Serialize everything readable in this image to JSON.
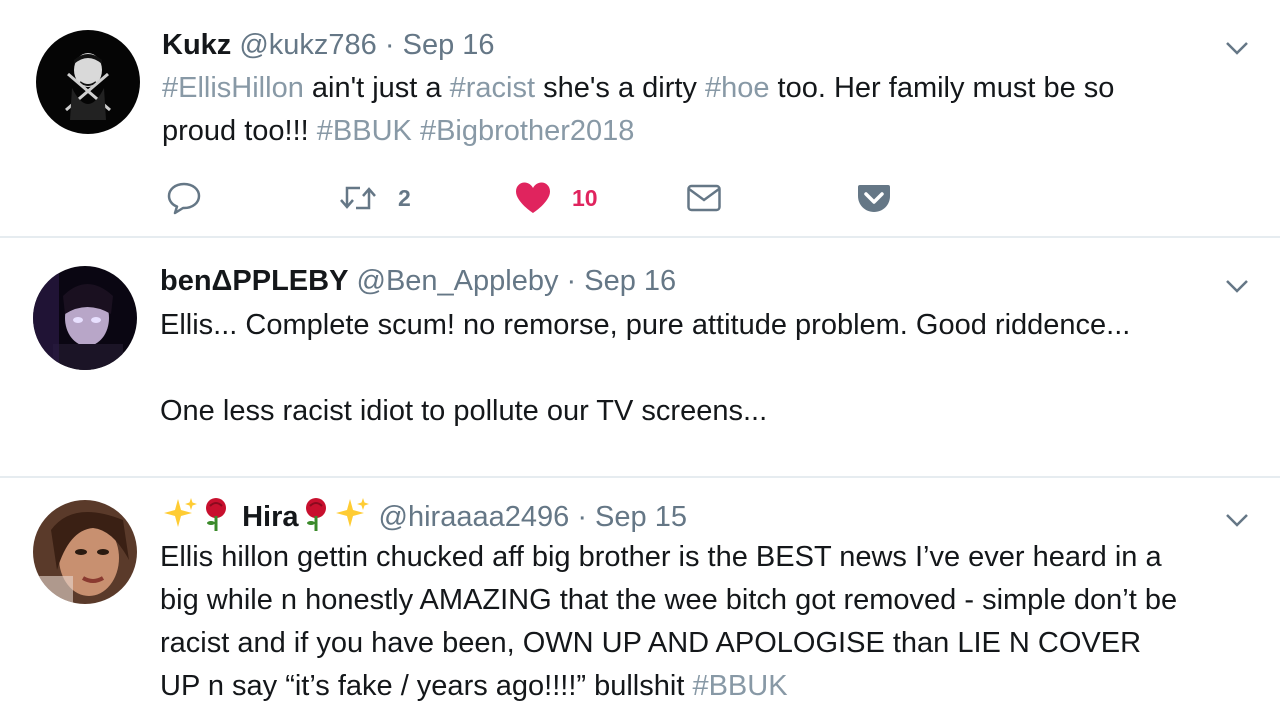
{
  "tweets": [
    {
      "name": "Kukz",
      "handle": "@kukz786",
      "dot": "·",
      "date": "Sep 16",
      "text": {
        "h1": "#EllisHillon",
        "t1": " ain't just a ",
        "h2": "#racist",
        "t2": " she's a dirty ",
        "h3": "#hoe",
        "t3": " too. Her family must be so",
        "t4": "proud too!!! ",
        "h4": "#BBUK",
        "t5": " ",
        "h5": "#Bigbrother2018"
      },
      "retweet_count": "2",
      "like_count": "10"
    },
    {
      "name": "benΔPPLEBY",
      "handle": "@Ben_Appleby",
      "dot": "·",
      "date": "Sep 16",
      "line1": "Ellis... Complete scum! no remorse, pure attitude problem. Good riddence...",
      "line2": "One less racist idiot to pollute our TV screens..."
    },
    {
      "name": "Hira",
      "handle": "@hiraaaa2496",
      "dot": "·",
      "date": "Sep 15",
      "line1": "Ellis hillon gettin chucked aff big brother is the BEST news I’ve ever heard in a",
      "line2": "big while n honestly AMAZING that the wee bitch got removed - simple don’t be",
      "line3": "racist and if you have been, OWN UP AND APOLOGISE than LIE N COVER",
      "line4": "UP n say “it’s fake / years ago!!!!” bullshit ",
      "hashtag": "#BBUK"
    }
  ],
  "colors": {
    "text": "#14171a",
    "secondary": "#657786",
    "hashtag": "#8899a6",
    "like": "#e0245e",
    "border": "#e6ecf0"
  },
  "icons": [
    "reply-icon",
    "retweet-icon",
    "heart-icon",
    "direct-message-icon",
    "pocket-icon",
    "chevron-down-icon",
    "sparkles-emoji",
    "rose-emoji"
  ]
}
